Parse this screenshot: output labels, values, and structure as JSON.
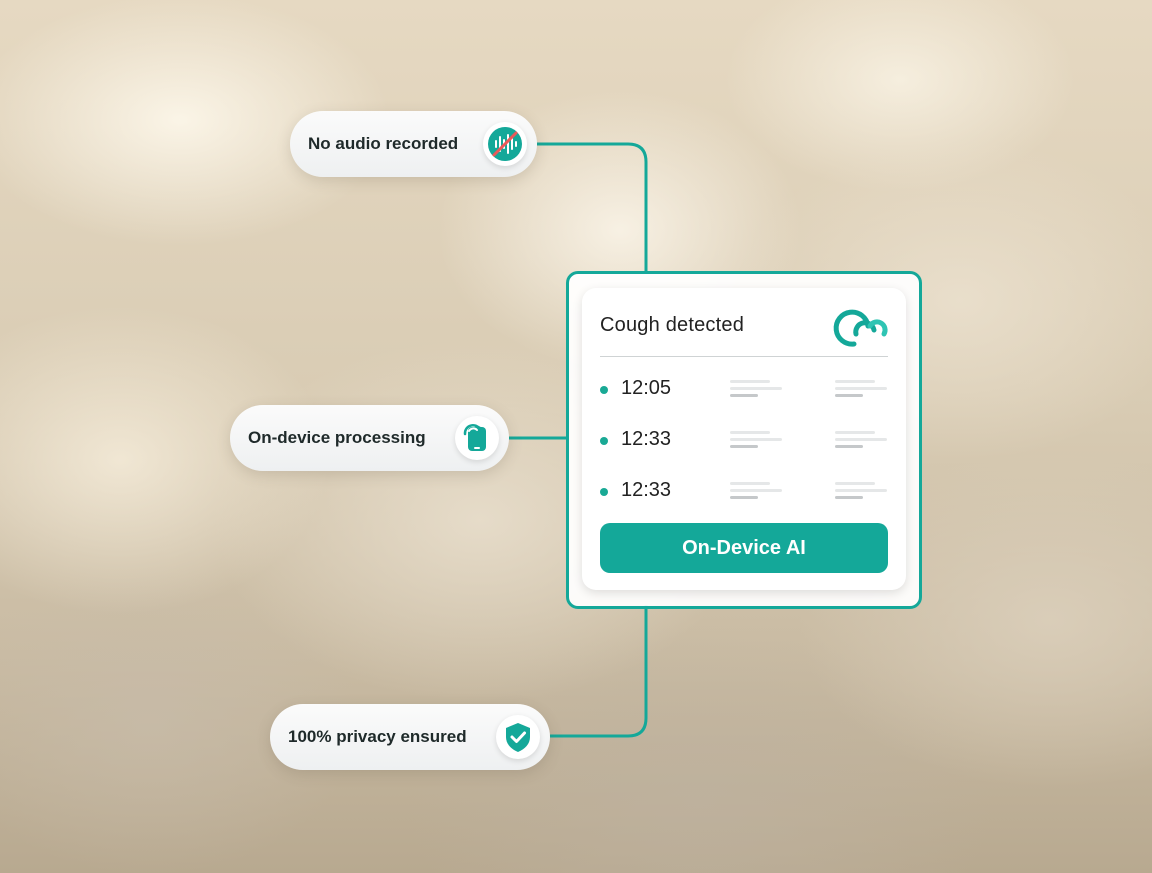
{
  "features": {
    "audio": {
      "label": "No audio recorded",
      "icon": "no-audio-icon"
    },
    "device": {
      "label": "On-device processing",
      "icon": "device-sync-icon"
    },
    "privacy": {
      "label": "100% privacy ensured",
      "icon": "shield-check-icon"
    }
  },
  "card": {
    "title": "Cough detected",
    "logo": "brand-logo-icon",
    "events": [
      {
        "time": "12:05"
      },
      {
        "time": "12:33"
      },
      {
        "time": "12:33"
      }
    ],
    "button_label": "On-Device AI"
  },
  "colors": {
    "accent": "#14a899",
    "accent_dot": "#19a995",
    "slash": "#e85a5a"
  }
}
